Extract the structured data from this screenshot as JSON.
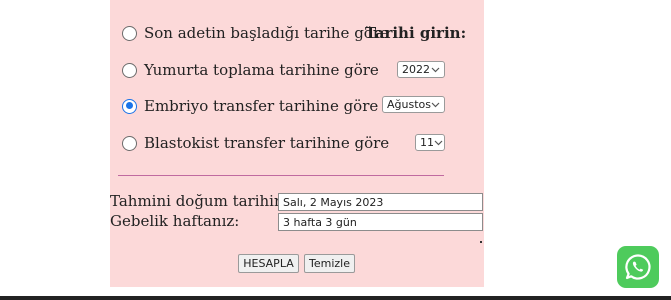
{
  "options": [
    {
      "label": "Son adetin başladığı tarihe göre",
      "checked": false
    },
    {
      "label": "Yumurta toplama tarihine göre",
      "checked": false
    },
    {
      "label": "Embriyo transfer tarihine göre",
      "checked": true
    },
    {
      "label": "Blastokist transfer tarihine göre",
      "checked": false
    }
  ],
  "date_heading": "Tarihi girin:",
  "selects": {
    "year": "2022",
    "month": "Ağustos",
    "day": "11"
  },
  "result": {
    "due_label": "Tahmini doğum tarihiniz:",
    "due_value": "Salı, 2 Mayıs 2023",
    "week_label": "Gebelik haftanız:",
    "week_value": "3 hafta 3 gün"
  },
  "buttons": {
    "calculate": "HESAPLA",
    "clear": "Temizle"
  },
  "icons": {
    "fab": "whatsapp-icon"
  },
  "colors": {
    "panel": "#fcd9d9",
    "accent": "#1a73e8",
    "divider": "#c06aa0",
    "fab": "#4ecb5c"
  }
}
